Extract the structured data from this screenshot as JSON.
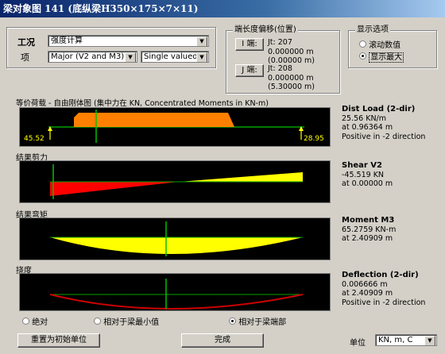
{
  "window": {
    "title": "梁对象图  141  (底纵梁H350×175×7×11)"
  },
  "case_section": {
    "case_label": "工况",
    "item_label": "项",
    "case_value": "强度计算",
    "component_value": "Major (V2 and M3)",
    "mode_value": "Single valued"
  },
  "end_offsets": {
    "title": "端长度偏移(位置)",
    "i_end": {
      "button": "I 端:",
      "jt": "Jt: 207",
      "val1": "0.000000 m",
      "val2": "(0.00000 m)"
    },
    "j_end": {
      "button": "J 端:",
      "jt": "Jt: 208",
      "val1": "0.000000 m",
      "val2": "(5.30000 m)"
    }
  },
  "display_options": {
    "title": "显示选项",
    "options": [
      "滚动数值",
      "显示最大"
    ],
    "selected": 1
  },
  "load_section": {
    "title": "等价荷载 - 自由刚体图 (集中力在 KN, Concentrated Moments in KN-m)",
    "left_value": "45.52",
    "right_value": "28.95",
    "info": {
      "heading": "Dist Load (2-dir)",
      "line1": "25.56 KN/m",
      "line2": "at 0.96364 m",
      "line3": "Positive in -2 direction"
    }
  },
  "shear_section": {
    "title": "结果剪力",
    "info": {
      "heading": "Shear V2",
      "line1": "-45.519 KN",
      "line2": "at 0.00000 m"
    }
  },
  "moment_section": {
    "title": "结果弯矩",
    "info": {
      "heading": "Moment M3",
      "line1": "65.2759 KN-m",
      "line2": "at 2.40909 m"
    }
  },
  "deflection_section": {
    "title": "挠度",
    "info": {
      "heading": "Deflection (2-dir)",
      "line1": "0.006666 m",
      "line2": "at 2.40909 m",
      "line3": "Positive in -2 direction"
    },
    "radio_options": [
      "绝对",
      "相对于梁最小值",
      "相对于梁端部"
    ],
    "radio_selected": 2
  },
  "footer": {
    "reset_button": "重置为初始单位",
    "done_button": "完成",
    "units_label": "单位",
    "units_value": "KN, m, C"
  },
  "colors": {
    "load": "#ff8000",
    "shear_pos": "#ffff00",
    "shear_neg": "#ff0000",
    "moment": "#ffff00",
    "deflection": "#cc0000",
    "marker": "#00c000",
    "axis": "#00a000"
  }
}
